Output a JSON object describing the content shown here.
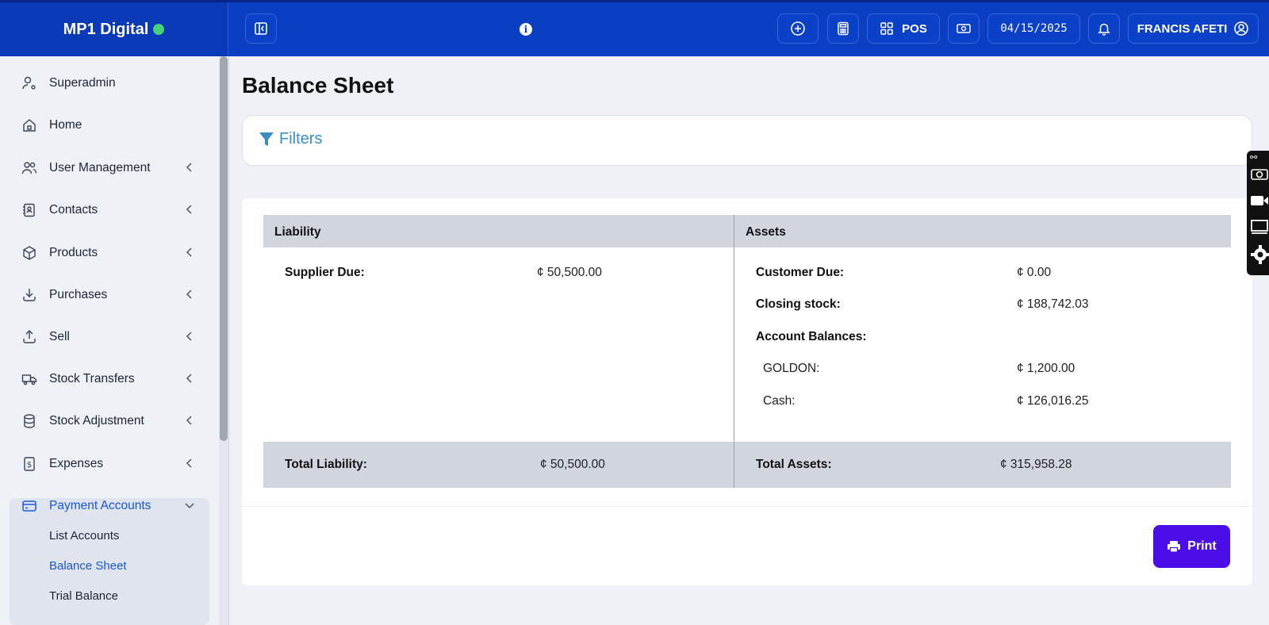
{
  "app": {
    "brand": "MP1 Digital"
  },
  "topbar": {
    "pos_label": "POS",
    "date": "04/15/2025",
    "user_name": "FRANCIS AFETI"
  },
  "sidebar": {
    "items": [
      {
        "label": "Superadmin",
        "icon": "user-cog-icon"
      },
      {
        "label": "Home",
        "icon": "home-icon"
      },
      {
        "label": "User Management",
        "icon": "users-icon"
      },
      {
        "label": "Contacts",
        "icon": "address-book-icon"
      },
      {
        "label": "Products",
        "icon": "box-icon"
      },
      {
        "label": "Purchases",
        "icon": "download-icon"
      },
      {
        "label": "Sell",
        "icon": "upload-icon"
      },
      {
        "label": "Stock Transfers",
        "icon": "truck-icon"
      },
      {
        "label": "Stock Adjustment",
        "icon": "database-icon"
      },
      {
        "label": "Expenses",
        "icon": "dollar-file-icon"
      },
      {
        "label": "Payment Accounts",
        "icon": "credit-card-icon"
      }
    ],
    "sub_items": [
      "List Accounts",
      "Balance Sheet",
      "Trial Balance"
    ],
    "active_color": "#1a56db"
  },
  "main": {
    "title": "Balance Sheet",
    "filters_label": "Filters",
    "table": {
      "liability_header": "Liability",
      "assets_header": "Assets",
      "supplier_due_label": "Supplier Due:",
      "supplier_due_value": "¢ 50,500.00",
      "customer_due_label": "Customer Due:",
      "customer_due_value": "¢ 0.00",
      "closing_stock_label": "Closing stock:",
      "closing_stock_value": "¢ 188,742.03",
      "account_balances_label": "Account Balances:",
      "accounts": [
        {
          "name": "GOLDON:",
          "value": "¢ 1,200.00"
        },
        {
          "name": "Cash:",
          "value": "¢ 126,016.25"
        }
      ],
      "total_liability_label": "Total Liability:",
      "total_liability_value": "¢ 50,500.00",
      "total_assets_label": "Total Assets:",
      "total_assets_value": "¢ 315,958.28"
    },
    "print_label": "Print"
  },
  "colors": {
    "topbar": "#0a3fc4",
    "print_button": "#4b0ee8",
    "filters": "#3a8fc4"
  }
}
